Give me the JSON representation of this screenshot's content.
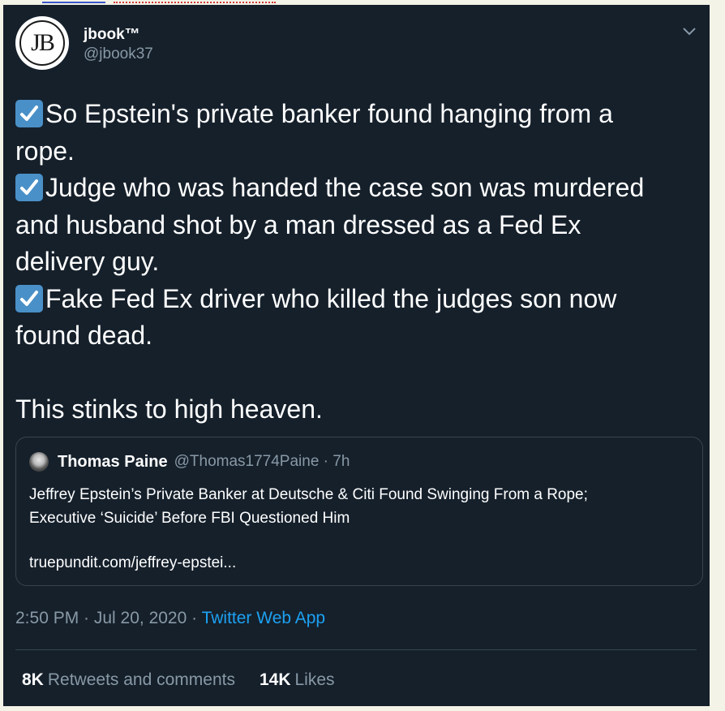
{
  "tweet": {
    "author": {
      "display_name": "jbook™",
      "handle": "@jbook37",
      "avatar_text": "JB"
    },
    "body_lines": [
      {
        "check": true,
        "text": "So Epstein's private banker found hanging from a"
      },
      {
        "check": false,
        "text": "rope."
      },
      {
        "check": true,
        "text": "Judge who was handed the case son was murdered"
      },
      {
        "check": false,
        "text": "and husband shot by a man dressed as a Fed Ex"
      },
      {
        "check": false,
        "text": "delivery guy."
      },
      {
        "check": true,
        "text": "Fake Fed Ex driver who killed the judges son now"
      },
      {
        "check": false,
        "text": "found dead."
      }
    ],
    "closing_line": "This stinks to high heaven.",
    "quoted": {
      "name": "Thomas Paine",
      "handle_time": "@Thomas1774Paine · 7h",
      "text_lines": [
        "Jeffrey Epstein’s Private Banker at Deutsche & Citi Found Swinging From a Rope;",
        "Executive ‘Suicide’ Before FBI Questioned Him"
      ],
      "link": "truepundit.com/jeffrey-epstei..."
    },
    "timestamp": "2:50 PM · Jul 20, 2020 · ",
    "source_app": "Twitter Web App",
    "stats": {
      "retweets_count": "8K",
      "retweets_label": "Retweets and comments",
      "likes_count": "14K",
      "likes_label": "Likes"
    },
    "colors": {
      "background": "#15202b",
      "secondary_text": "#8899a6",
      "accent": "#1da1f2",
      "border": "#38444d"
    }
  }
}
